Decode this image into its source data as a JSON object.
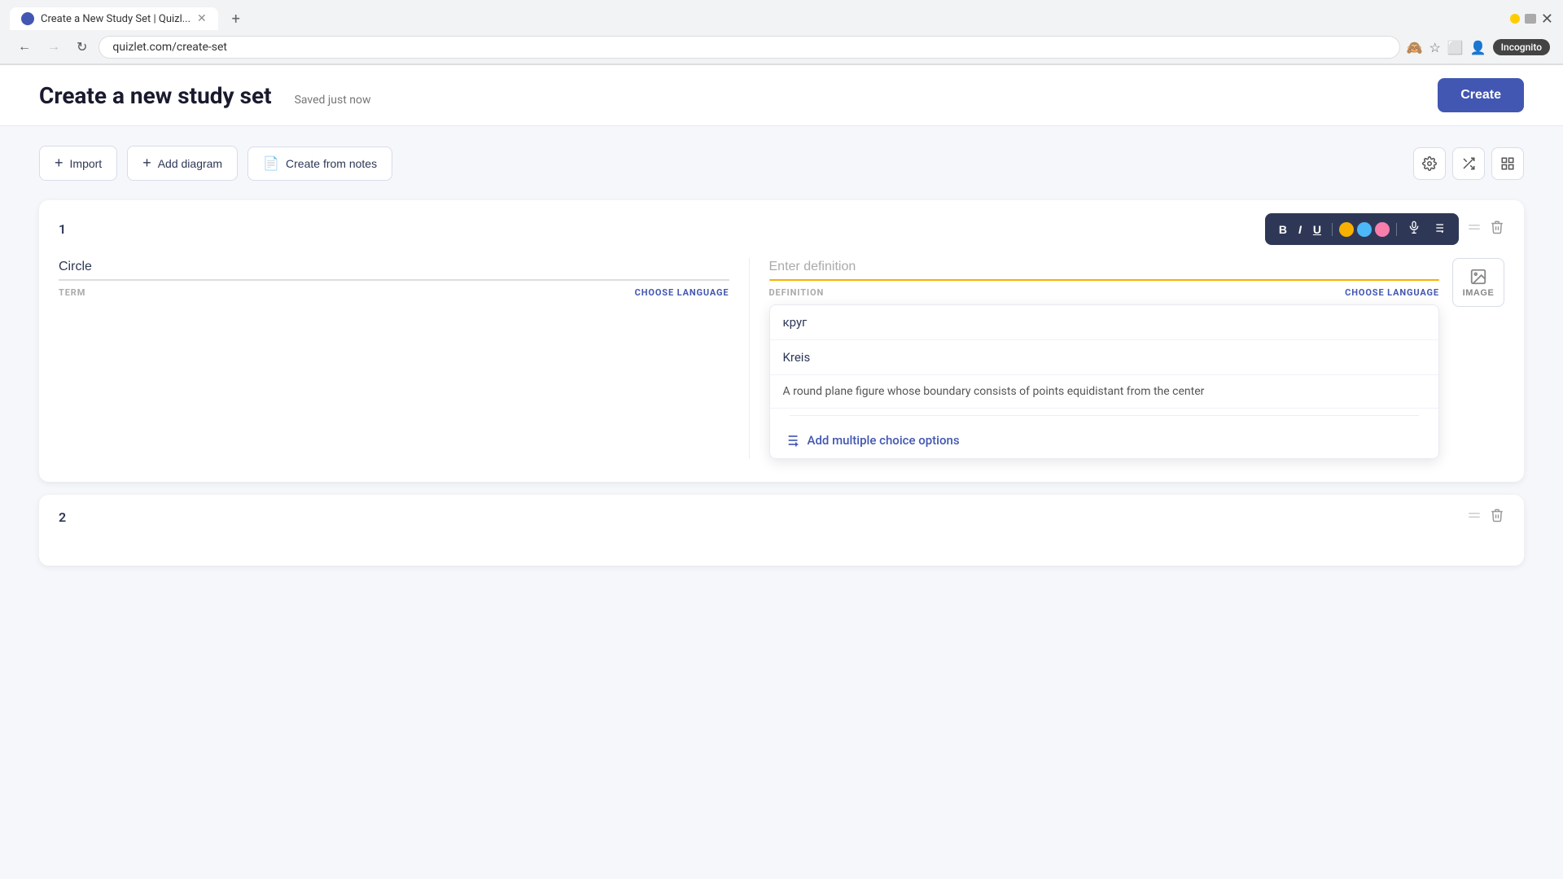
{
  "browser": {
    "tab_title": "Create a New Study Set | Quizl...",
    "url": "quizlet.com/create-set",
    "new_tab_label": "+",
    "incognito_label": "Incognito"
  },
  "header": {
    "title": "Create a new study set",
    "saved_status": "Saved just now",
    "create_button": "Create"
  },
  "toolbar": {
    "import_label": "Import",
    "add_diagram_label": "Add diagram",
    "create_from_notes_label": "Create from notes"
  },
  "format_toolbar": {
    "bold": "B",
    "italic": "I",
    "underline": "U",
    "mic": "🎤",
    "more": "≡+"
  },
  "colors": {
    "yellow": "#f8b100",
    "blue": "#4db8f8",
    "pink": "#f87eac",
    "accent": "#4257b2",
    "active_underline": "#f8b100"
  },
  "card1": {
    "number": "1",
    "term_value": "Circle",
    "term_placeholder": "",
    "def_placeholder": "Enter definition",
    "term_label": "TERM",
    "def_label": "DEFINITION",
    "choose_lang": "CHOOSE LANGUAGE",
    "image_label": "IMAGE",
    "suggestions": [
      {
        "text": "круг"
      },
      {
        "text": "Kreis"
      },
      {
        "text": "A round plane figure whose boundary consists of points equidistant from the center"
      }
    ],
    "add_choice_label": "Add multiple choice options"
  },
  "card2": {
    "number": "2"
  }
}
